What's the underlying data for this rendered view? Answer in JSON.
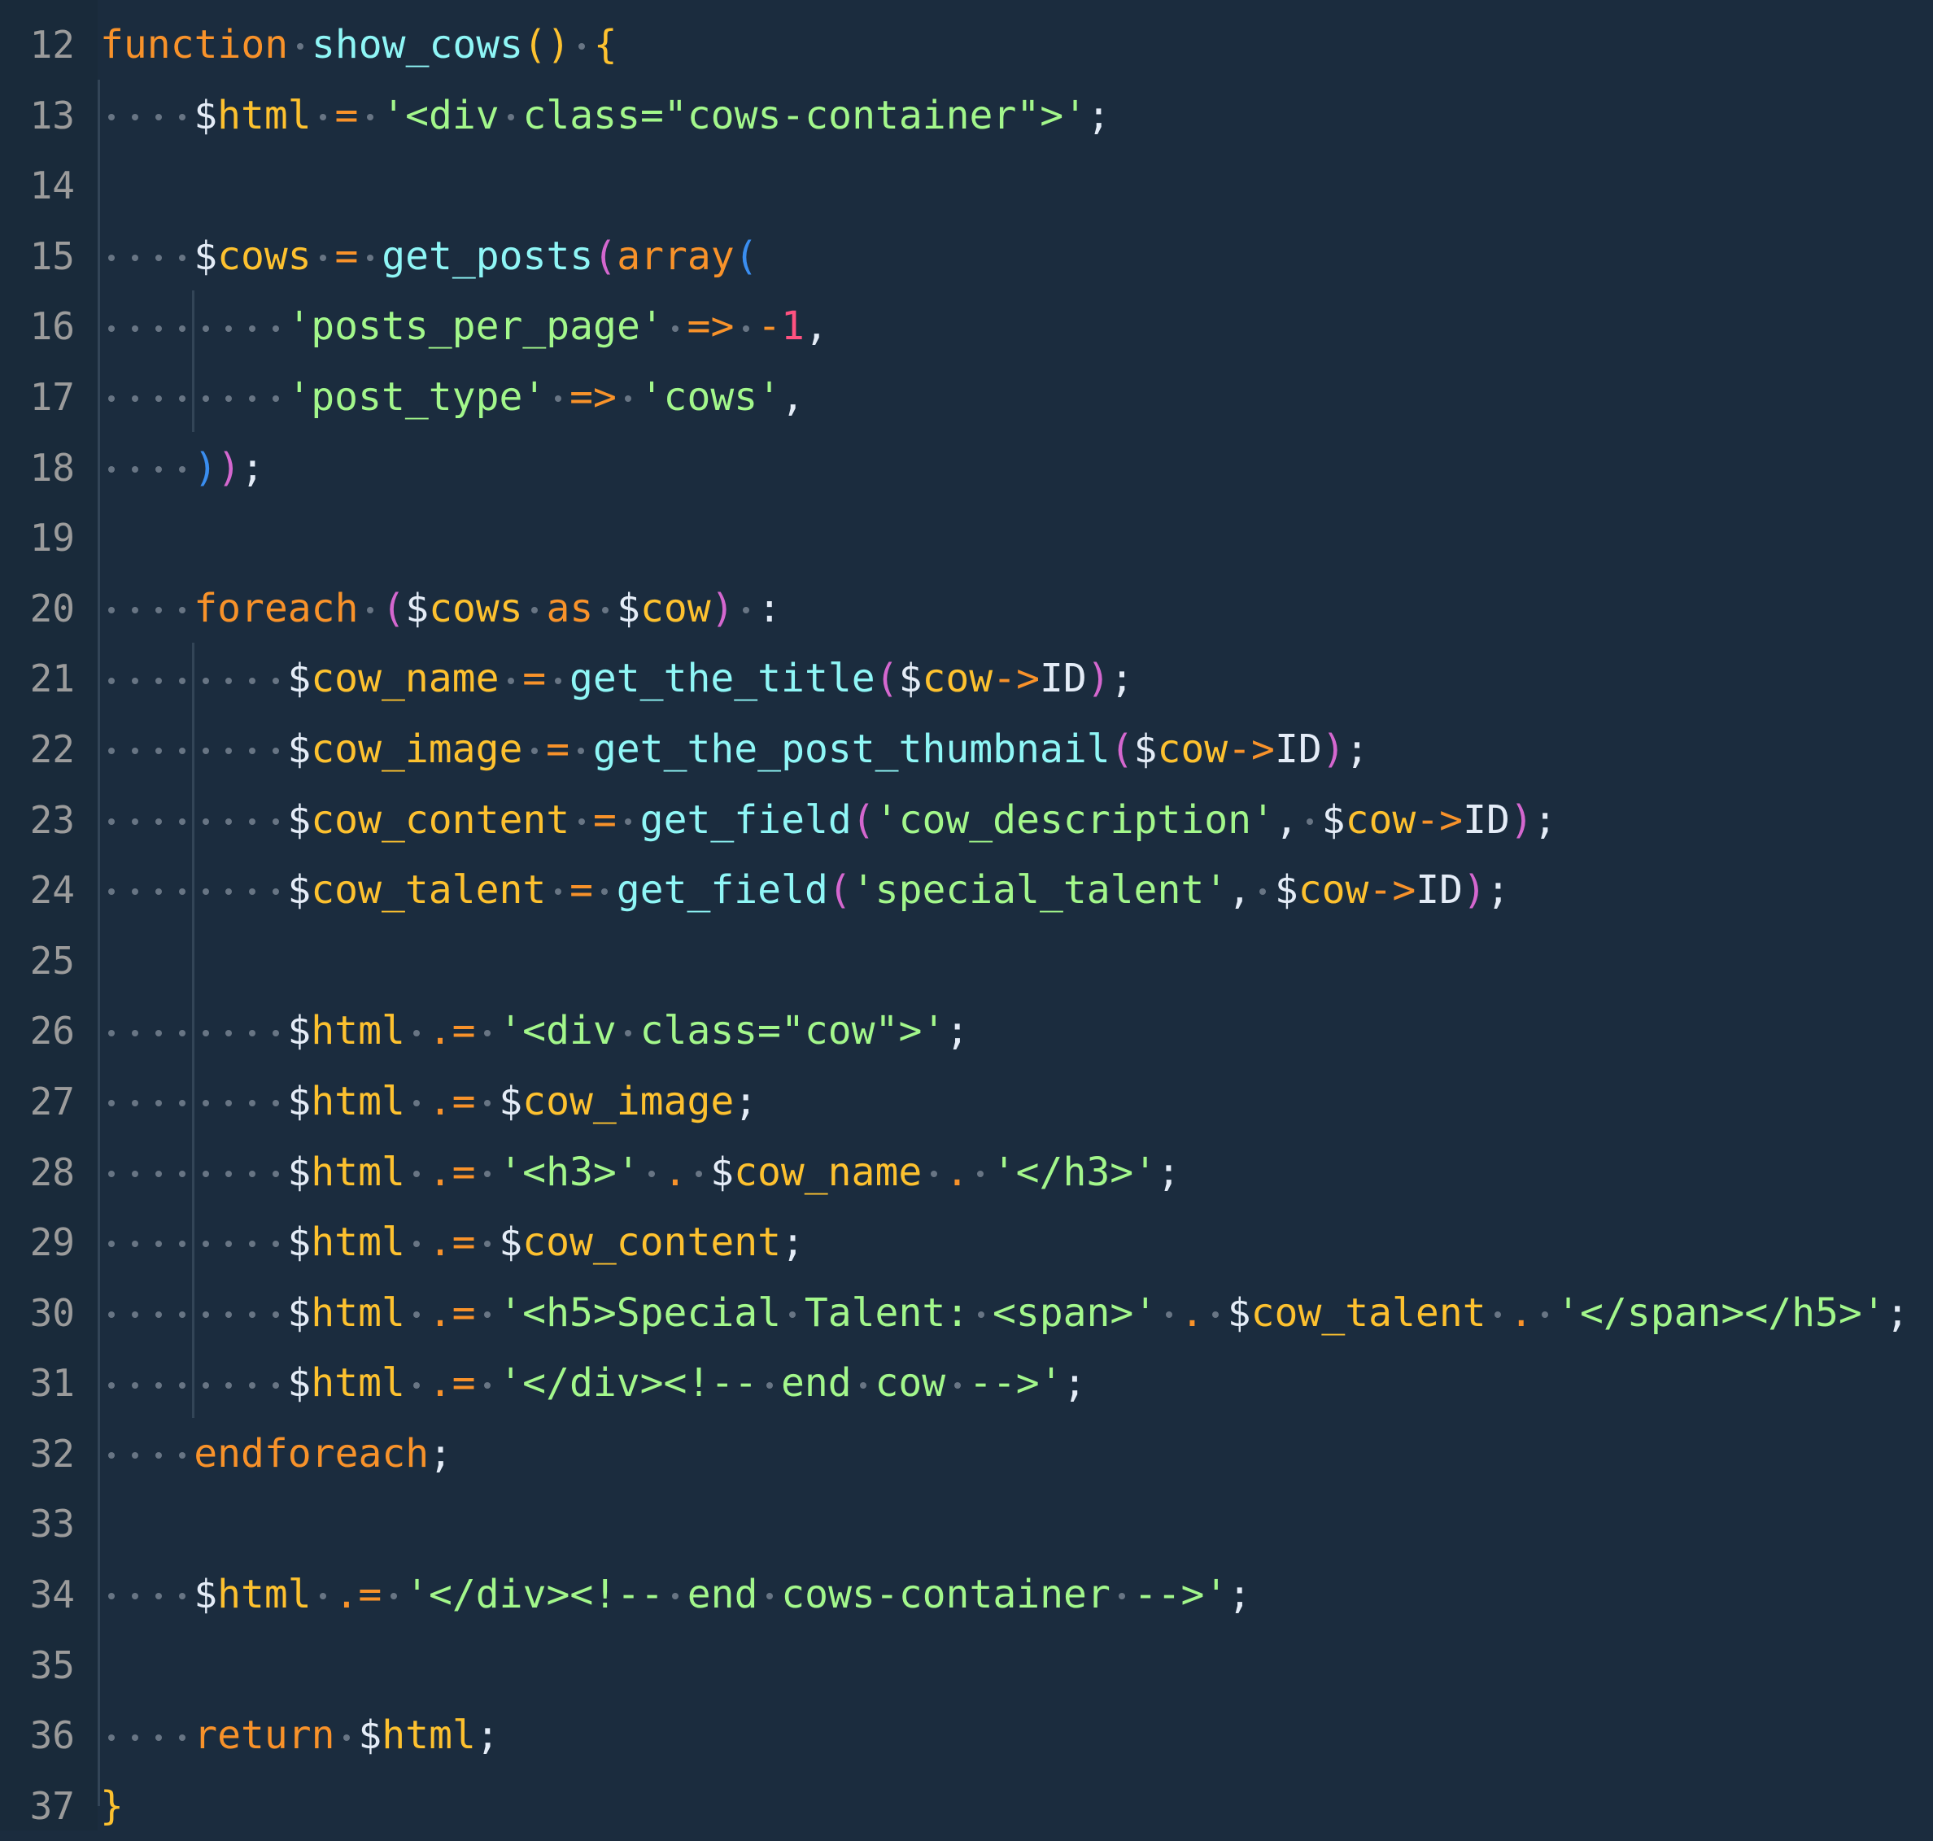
{
  "editor": {
    "language": "php",
    "theme_colors": {
      "background": "#1b2c3e",
      "gutter": "#192a3a",
      "keyword": "#f8922a",
      "function": "#8ff6f6",
      "variable": "#fdc12f",
      "string": "#a3f78b",
      "number": "#ff5280"
    },
    "lines": [
      {
        "number": "12",
        "indent": 0,
        "tokens": [
          [
            "kw",
            "function"
          ],
          [
            "ws",
            " "
          ],
          [
            "fn",
            "show_cows"
          ],
          [
            "b1",
            "("
          ],
          [
            "b1",
            ")"
          ],
          [
            "ws",
            " "
          ],
          [
            "b1",
            "{"
          ]
        ]
      },
      {
        "number": "13",
        "indent": 4,
        "tokens": [
          [
            "dollar",
            "$"
          ],
          [
            "var",
            "html"
          ],
          [
            "ws",
            " "
          ],
          [
            "op",
            "="
          ],
          [
            "ws",
            " "
          ],
          [
            "str",
            "'<div class=\"cows-container\">'"
          ],
          [
            "punc",
            ";"
          ]
        ]
      },
      {
        "number": "14",
        "indent": 0,
        "tokens": []
      },
      {
        "number": "15",
        "indent": 4,
        "tokens": [
          [
            "dollar",
            "$"
          ],
          [
            "var",
            "cows"
          ],
          [
            "ws",
            " "
          ],
          [
            "op",
            "="
          ],
          [
            "ws",
            " "
          ],
          [
            "fn",
            "get_posts"
          ],
          [
            "b2",
            "("
          ],
          [
            "kw",
            "array"
          ],
          [
            "b3",
            "("
          ]
        ]
      },
      {
        "number": "16",
        "indent": 8,
        "tokens": [
          [
            "str",
            "'posts_per_page'"
          ],
          [
            "ws",
            " "
          ],
          [
            "op",
            "=>"
          ],
          [
            "ws",
            " "
          ],
          [
            "op",
            "-"
          ],
          [
            "num",
            "1"
          ],
          [
            "punc",
            ","
          ]
        ]
      },
      {
        "number": "17",
        "indent": 8,
        "tokens": [
          [
            "str",
            "'post_type'"
          ],
          [
            "ws",
            " "
          ],
          [
            "op",
            "=>"
          ],
          [
            "ws",
            " "
          ],
          [
            "str",
            "'cows'"
          ],
          [
            "punc",
            ","
          ]
        ]
      },
      {
        "number": "18",
        "indent": 4,
        "tokens": [
          [
            "b3",
            ")"
          ],
          [
            "b2",
            ")"
          ],
          [
            "punc",
            ";"
          ]
        ]
      },
      {
        "number": "19",
        "indent": 0,
        "tokens": []
      },
      {
        "number": "20",
        "indent": 4,
        "tokens": [
          [
            "kw",
            "foreach"
          ],
          [
            "ws",
            " "
          ],
          [
            "b2",
            "("
          ],
          [
            "dollar",
            "$"
          ],
          [
            "var",
            "cows"
          ],
          [
            "ws",
            " "
          ],
          [
            "kw",
            "as"
          ],
          [
            "ws",
            " "
          ],
          [
            "dollar",
            "$"
          ],
          [
            "var",
            "cow"
          ],
          [
            "b2",
            ")"
          ],
          [
            "ws",
            " "
          ],
          [
            "punc",
            ":"
          ]
        ]
      },
      {
        "number": "21",
        "indent": 8,
        "tokens": [
          [
            "dollar",
            "$"
          ],
          [
            "var",
            "cow_name"
          ],
          [
            "ws",
            " "
          ],
          [
            "op",
            "="
          ],
          [
            "ws",
            " "
          ],
          [
            "fn",
            "get_the_title"
          ],
          [
            "b2",
            "("
          ],
          [
            "dollar",
            "$"
          ],
          [
            "var",
            "cow"
          ],
          [
            "op",
            "->"
          ],
          [
            "prop",
            "ID"
          ],
          [
            "b2",
            ")"
          ],
          [
            "punc",
            ";"
          ]
        ]
      },
      {
        "number": "22",
        "indent": 8,
        "tokens": [
          [
            "dollar",
            "$"
          ],
          [
            "var",
            "cow_image"
          ],
          [
            "ws",
            " "
          ],
          [
            "op",
            "="
          ],
          [
            "ws",
            " "
          ],
          [
            "fn",
            "get_the_post_thumbnail"
          ],
          [
            "b2",
            "("
          ],
          [
            "dollar",
            "$"
          ],
          [
            "var",
            "cow"
          ],
          [
            "op",
            "->"
          ],
          [
            "prop",
            "ID"
          ],
          [
            "b2",
            ")"
          ],
          [
            "punc",
            ";"
          ]
        ]
      },
      {
        "number": "23",
        "indent": 8,
        "tokens": [
          [
            "dollar",
            "$"
          ],
          [
            "var",
            "cow_content"
          ],
          [
            "ws",
            " "
          ],
          [
            "op",
            "="
          ],
          [
            "ws",
            " "
          ],
          [
            "fn",
            "get_field"
          ],
          [
            "b2",
            "("
          ],
          [
            "str",
            "'cow_description'"
          ],
          [
            "punc",
            ","
          ],
          [
            "ws",
            " "
          ],
          [
            "dollar",
            "$"
          ],
          [
            "var",
            "cow"
          ],
          [
            "op",
            "->"
          ],
          [
            "prop",
            "ID"
          ],
          [
            "b2",
            ")"
          ],
          [
            "punc",
            ";"
          ]
        ]
      },
      {
        "number": "24",
        "indent": 8,
        "tokens": [
          [
            "dollar",
            "$"
          ],
          [
            "var",
            "cow_talent"
          ],
          [
            "ws",
            " "
          ],
          [
            "op",
            "="
          ],
          [
            "ws",
            " "
          ],
          [
            "fn",
            "get_field"
          ],
          [
            "b2",
            "("
          ],
          [
            "str",
            "'special_talent'"
          ],
          [
            "punc",
            ","
          ],
          [
            "ws",
            " "
          ],
          [
            "dollar",
            "$"
          ],
          [
            "var",
            "cow"
          ],
          [
            "op",
            "->"
          ],
          [
            "prop",
            "ID"
          ],
          [
            "b2",
            ")"
          ],
          [
            "punc",
            ";"
          ]
        ]
      },
      {
        "number": "25",
        "indent": 0,
        "tokens": []
      },
      {
        "number": "26",
        "indent": 8,
        "tokens": [
          [
            "dollar",
            "$"
          ],
          [
            "var",
            "html"
          ],
          [
            "ws",
            " "
          ],
          [
            "op",
            ".="
          ],
          [
            "ws",
            " "
          ],
          [
            "str",
            "'<div class=\"cow\">'"
          ],
          [
            "punc",
            ";"
          ]
        ]
      },
      {
        "number": "27",
        "indent": 8,
        "tokens": [
          [
            "dollar",
            "$"
          ],
          [
            "var",
            "html"
          ],
          [
            "ws",
            " "
          ],
          [
            "op",
            ".="
          ],
          [
            "ws",
            " "
          ],
          [
            "dollar",
            "$"
          ],
          [
            "var",
            "cow_image"
          ],
          [
            "punc",
            ";"
          ]
        ]
      },
      {
        "number": "28",
        "indent": 8,
        "tokens": [
          [
            "dollar",
            "$"
          ],
          [
            "var",
            "html"
          ],
          [
            "ws",
            " "
          ],
          [
            "op",
            ".="
          ],
          [
            "ws",
            " "
          ],
          [
            "str",
            "'<h3>'"
          ],
          [
            "ws",
            " "
          ],
          [
            "op",
            "."
          ],
          [
            "ws",
            " "
          ],
          [
            "dollar",
            "$"
          ],
          [
            "var",
            "cow_name"
          ],
          [
            "ws",
            " "
          ],
          [
            "op",
            "."
          ],
          [
            "ws",
            " "
          ],
          [
            "str",
            "'</h3>'"
          ],
          [
            "punc",
            ";"
          ]
        ]
      },
      {
        "number": "29",
        "indent": 8,
        "tokens": [
          [
            "dollar",
            "$"
          ],
          [
            "var",
            "html"
          ],
          [
            "ws",
            " "
          ],
          [
            "op",
            ".="
          ],
          [
            "ws",
            " "
          ],
          [
            "dollar",
            "$"
          ],
          [
            "var",
            "cow_content"
          ],
          [
            "punc",
            ";"
          ]
        ]
      },
      {
        "number": "30",
        "indent": 8,
        "tokens": [
          [
            "dollar",
            "$"
          ],
          [
            "var",
            "html"
          ],
          [
            "ws",
            " "
          ],
          [
            "op",
            ".="
          ],
          [
            "ws",
            " "
          ],
          [
            "str",
            "'<h5>Special Talent: <span>'"
          ],
          [
            "ws",
            " "
          ],
          [
            "op",
            "."
          ],
          [
            "ws",
            " "
          ],
          [
            "dollar",
            "$"
          ],
          [
            "var",
            "cow_talent"
          ],
          [
            "ws",
            " "
          ],
          [
            "op",
            "."
          ],
          [
            "ws",
            " "
          ],
          [
            "str",
            "'</span></h5>'"
          ],
          [
            "punc",
            ";"
          ]
        ]
      },
      {
        "number": "31",
        "indent": 8,
        "tokens": [
          [
            "dollar",
            "$"
          ],
          [
            "var",
            "html"
          ],
          [
            "ws",
            " "
          ],
          [
            "op",
            ".="
          ],
          [
            "ws",
            " "
          ],
          [
            "str",
            "'</div><!-- end cow -->'"
          ],
          [
            "punc",
            ";"
          ]
        ]
      },
      {
        "number": "32",
        "indent": 4,
        "tokens": [
          [
            "kw",
            "endforeach"
          ],
          [
            "punc",
            ";"
          ]
        ]
      },
      {
        "number": "33",
        "indent": 0,
        "tokens": []
      },
      {
        "number": "34",
        "indent": 4,
        "tokens": [
          [
            "dollar",
            "$"
          ],
          [
            "var",
            "html"
          ],
          [
            "ws",
            " "
          ],
          [
            "op",
            ".="
          ],
          [
            "ws",
            " "
          ],
          [
            "str",
            "'</div><!-- end cows-container -->'"
          ],
          [
            "punc",
            ";"
          ]
        ]
      },
      {
        "number": "35",
        "indent": 0,
        "tokens": []
      },
      {
        "number": "36",
        "indent": 4,
        "tokens": [
          [
            "kw",
            "return"
          ],
          [
            "ws",
            " "
          ],
          [
            "dollar",
            "$"
          ],
          [
            "var",
            "html"
          ],
          [
            "punc",
            ";"
          ]
        ]
      },
      {
        "number": "37",
        "indent": 0,
        "tokens": [
          [
            "b1",
            "}"
          ]
        ]
      }
    ]
  }
}
